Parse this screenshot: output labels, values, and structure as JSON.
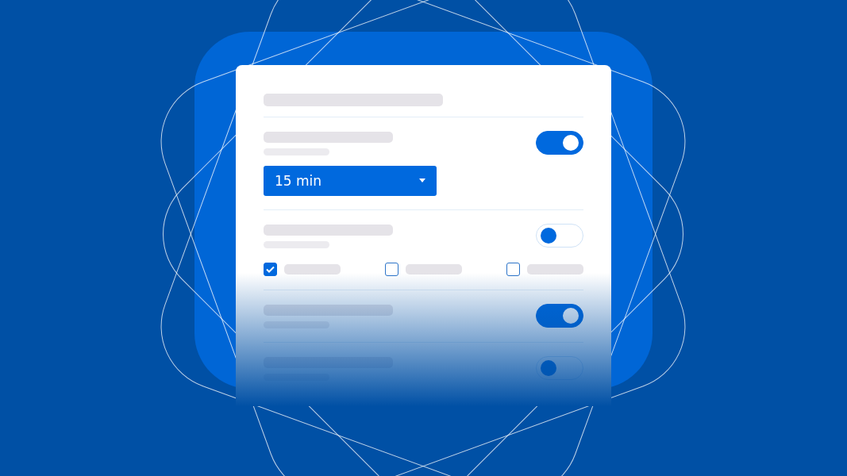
{
  "settings": [
    {
      "kind": "dropdown",
      "on": true,
      "value": "15 min"
    },
    {
      "kind": "checkboxes",
      "on": false,
      "options": [
        {
          "checked": true
        },
        {
          "checked": false
        },
        {
          "checked": false
        }
      ]
    },
    {
      "kind": "plain",
      "on": true
    },
    {
      "kind": "plain",
      "on": false
    }
  ]
}
